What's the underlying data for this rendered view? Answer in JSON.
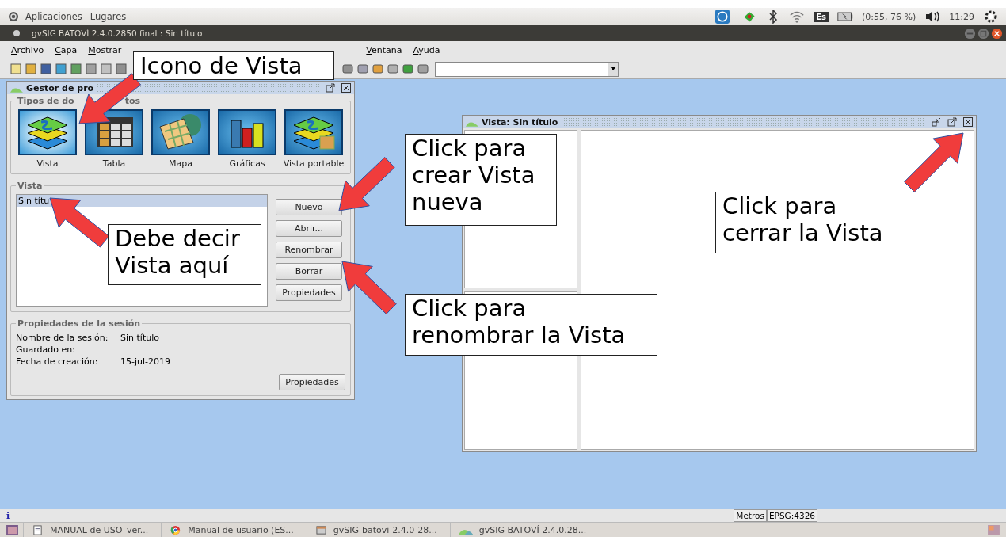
{
  "top_panel": {
    "menus": [
      "Aplicaciones",
      "Lugares"
    ],
    "keyboard": "Es",
    "battery": "(0:55, 76 %)",
    "time": "11:29"
  },
  "window": {
    "title": "gvSIG BATOVÍ 2.4.0.2850 final : Sin título"
  },
  "menu_left": [
    "Archivo",
    "Capa",
    "Mostrar"
  ],
  "menu_right": [
    "Ventana",
    "Ayuda"
  ],
  "project_manager": {
    "title": "Gestor de pro",
    "types_legend": "Tipos de do",
    "types_legend_tail": "tos",
    "document_types": [
      {
        "kind": "vista",
        "label": "Vista",
        "selected": true
      },
      {
        "kind": "tabla",
        "label": "Tabla",
        "selected": false
      },
      {
        "kind": "mapa",
        "label": "Mapa",
        "selected": false
      },
      {
        "kind": "graficas",
        "label": "Gráficas",
        "selected": false
      },
      {
        "kind": "vista_portable",
        "label": "Vista portable",
        "selected": false
      }
    ],
    "list_legend": "Vista",
    "documents": [
      {
        "name": "Sin títu",
        "selected": true
      }
    ],
    "buttons": [
      "Nuevo",
      "Abrir...",
      "Renombrar",
      "Borrar",
      "Propiedades"
    ],
    "session_legend": "Propiedades de la sesión",
    "session": [
      {
        "label": "Nombre de la sesión:",
        "value": "Sin título"
      },
      {
        "label": "Guardado en:"
      },
      {
        "label": "Fecha de creación:",
        "value": "15-jul-2019"
      }
    ],
    "session_button": "Propiedades"
  },
  "view_window": {
    "title": "Vista: Sin título"
  },
  "annotations": [
    "Icono de Vista",
    "Debe decir Vista aquí",
    "Click para crear Vista nueva",
    "Click para renombrar la Vista",
    "Click para cerrar la Vista"
  ],
  "status_bar": {
    "info": "i",
    "units": "Metros",
    "crs": "EPSG:4326"
  },
  "taskbar": [
    {
      "kind": "doc",
      "label": "MANUAL de USO_ver..."
    },
    {
      "kind": "browser",
      "label": "Manual de usuario (ES..."
    },
    {
      "kind": "file",
      "label": "gvSIG-batovi-2.4.0-28..."
    },
    {
      "kind": "gvsig",
      "label": "gvSIG BATOVÍ 2.4.0.28..."
    }
  ]
}
